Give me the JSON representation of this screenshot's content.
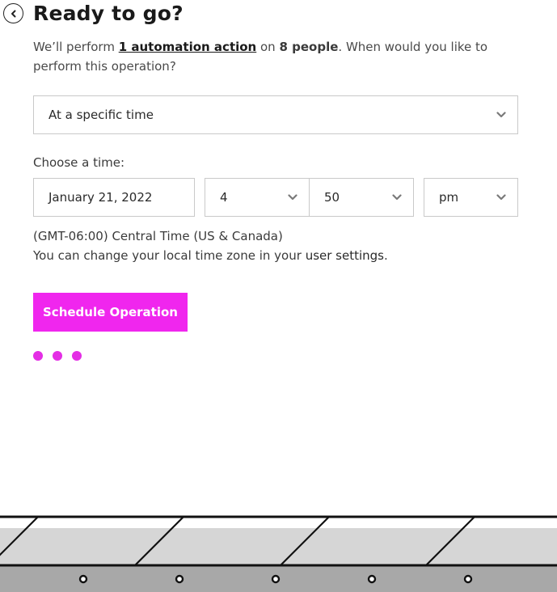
{
  "header": {
    "back_icon": "chevron-left-circle-icon",
    "title": "Ready to go?"
  },
  "intro": {
    "prefix": "We’ll perform ",
    "action_link": "1 automation action",
    "middle": " on ",
    "people": "8 people",
    "suffix": ". When would you like to perform this operation?"
  },
  "when_select": {
    "value": "At a specific time",
    "icon": "chevron-down-icon"
  },
  "time": {
    "label": "Choose a time:",
    "date": "January 21, 2022",
    "hour": "4",
    "minute": "50",
    "ampm": "pm"
  },
  "timezone": {
    "line1": "(GMT-06:00) Central Time (US & Canada)",
    "line2_prefix": "You can change your local time zone in your ",
    "settings_link": "user settings",
    "line2_suffix": "."
  },
  "actions": {
    "schedule_label": "Schedule Operation"
  },
  "colors": {
    "accent": "#f026ee",
    "loading_dots": "#e42ee5"
  }
}
